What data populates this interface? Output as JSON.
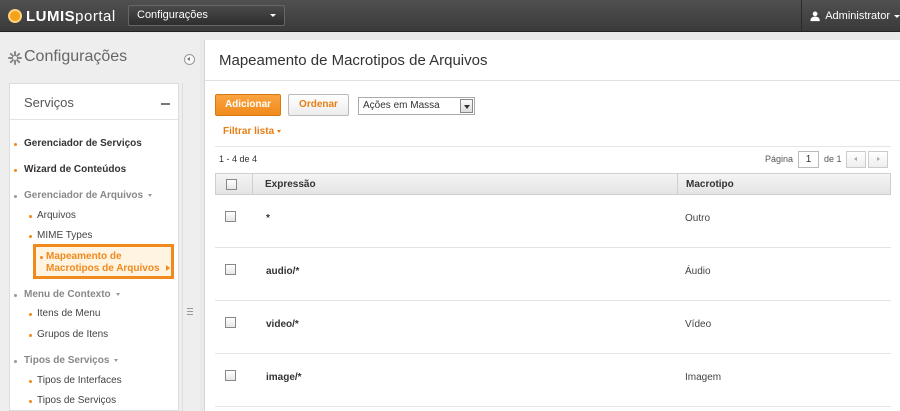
{
  "topbar": {
    "logo_prefix": "LUMIS",
    "logo_suffix": "portal",
    "context_select": "Configurações",
    "user_name": "Administrator"
  },
  "sidebar": {
    "title": "Configurações",
    "panel_title": "Serviços",
    "items": [
      {
        "label": "Gerenciador de Serviços"
      },
      {
        "label": "Wizard de Conteúdos"
      },
      {
        "label": "Gerenciador de Arquivos"
      },
      {
        "label": "Arquivos"
      },
      {
        "label": "MIME Types"
      },
      {
        "label": "Mapeamento de Macrotipos de Arquivos"
      },
      {
        "label": "Menu de Contexto"
      },
      {
        "label": "Itens de Menu"
      },
      {
        "label": "Grupos de Itens"
      },
      {
        "label": "Tipos de Serviços"
      },
      {
        "label": "Tipos de Interfaces"
      },
      {
        "label": "Tipos de Serviços"
      }
    ]
  },
  "main": {
    "title": "Mapeamento de Macrotipos de Arquivos",
    "add_label": "Adicionar",
    "order_label": "Ordenar",
    "bulk_actions": "Ações em Massa",
    "filter_label": "Filtrar lista",
    "count_text": "1 - 4 de 4",
    "page_label": "Página",
    "page_value": "1",
    "page_of": "de 1",
    "columns": [
      "Expressão",
      "Macrotipo"
    ],
    "rows": [
      {
        "expr": "*",
        "type": "Outro"
      },
      {
        "expr": "audio/*",
        "type": "Áudio"
      },
      {
        "expr": "video/*",
        "type": "Vídeo"
      },
      {
        "expr": "image/*",
        "type": "Imagem"
      }
    ]
  }
}
